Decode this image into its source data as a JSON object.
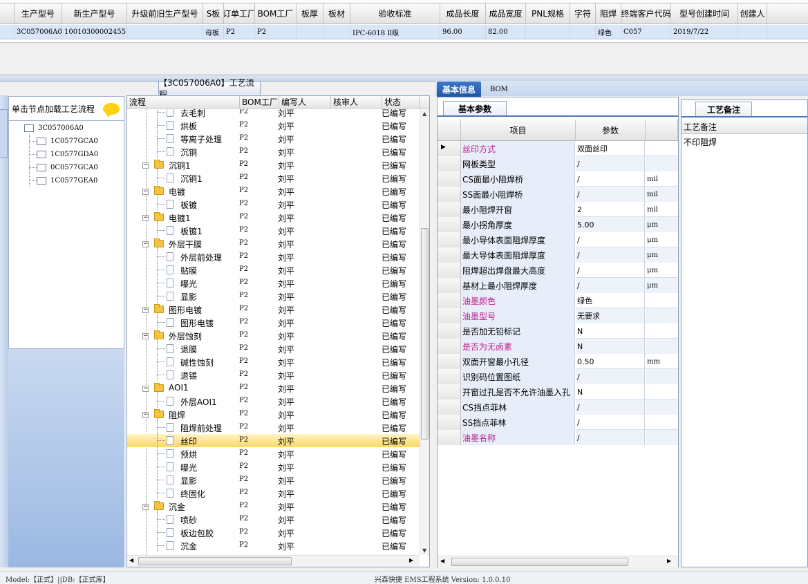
{
  "top_grid": {
    "headers": [
      "生产型号",
      "新生产型号",
      "升级前旧生产型号",
      "S板",
      "订单工厂",
      "BOM工厂",
      "板厚",
      "板材",
      "验收标准",
      "成品长度",
      "成品宽度",
      "PNL规格",
      "字符",
      "阻焊",
      "终端客户代码",
      "型号创建时间",
      "创建人"
    ],
    "row": [
      "3C057006A0",
      "10010300002455",
      "",
      "母板",
      "P2",
      "P2",
      "",
      "",
      "IPC-6018 Ⅱ级",
      "96.00",
      "82.00",
      "",
      "",
      "绿色",
      "C057",
      "2019/7/22",
      ""
    ]
  },
  "left_panel": {
    "header": "单击节点加载工艺流程",
    "nodes": [
      "3C057006A0",
      "1C0577GCA0",
      "1C0577GDA0",
      "0C0577GCA0",
      "1C0577GEA0"
    ]
  },
  "process": {
    "title": "【3C057006A0】工艺流程",
    "headers": [
      "流程",
      "BOM工厂",
      "编写人",
      "核审人",
      "状态"
    ],
    "rows": [
      {
        "name": "去毛刺",
        "type": "step",
        "bom": "P2",
        "writer": "刘平",
        "status": "已编写"
      },
      {
        "name": "烘板",
        "type": "step",
        "bom": "P2",
        "writer": "刘平",
        "status": "已编写"
      },
      {
        "name": "等离子处理",
        "type": "step",
        "bom": "P2",
        "writer": "刘平",
        "status": "已编写"
      },
      {
        "name": "沉铜",
        "type": "step",
        "bom": "P2",
        "writer": "刘平",
        "status": "已编写"
      },
      {
        "name": "沉铜1",
        "type": "group",
        "bom": "P2",
        "writer": "刘平",
        "status": "已编写"
      },
      {
        "name": "沉铜1",
        "type": "step",
        "bom": "P2",
        "writer": "刘平",
        "status": "已编写"
      },
      {
        "name": "电镀",
        "type": "group",
        "bom": "P2",
        "writer": "刘平",
        "status": "已编写"
      },
      {
        "name": "板镀",
        "type": "step",
        "bom": "P2",
        "writer": "刘平",
        "status": "已编写"
      },
      {
        "name": "电镀1",
        "type": "group",
        "bom": "P2",
        "writer": "刘平",
        "status": "已编写"
      },
      {
        "name": "板镀1",
        "type": "step",
        "bom": "P2",
        "writer": "刘平",
        "status": "已编写"
      },
      {
        "name": "外层干膜",
        "type": "group",
        "bom": "P2",
        "writer": "刘平",
        "status": "已编写"
      },
      {
        "name": "外层前处理",
        "type": "step",
        "bom": "P2",
        "writer": "刘平",
        "status": "已编写"
      },
      {
        "name": "贴膜",
        "type": "step",
        "bom": "P2",
        "writer": "刘平",
        "status": "已编写"
      },
      {
        "name": "曝光",
        "type": "step",
        "bom": "P2",
        "writer": "刘平",
        "status": "已编写"
      },
      {
        "name": "显影",
        "type": "step",
        "bom": "P2",
        "writer": "刘平",
        "status": "已编写"
      },
      {
        "name": "图形电镀",
        "type": "group",
        "bom": "P2",
        "writer": "刘平",
        "status": "已编写"
      },
      {
        "name": "图形电镀",
        "type": "step",
        "bom": "P2",
        "writer": "刘平",
        "status": "已编写"
      },
      {
        "name": "外层蚀刻",
        "type": "group",
        "bom": "P2",
        "writer": "刘平",
        "status": "已编写"
      },
      {
        "name": "退膜",
        "type": "step",
        "bom": "P2",
        "writer": "刘平",
        "status": "已编写"
      },
      {
        "name": "碱性蚀刻",
        "type": "step",
        "bom": "P2",
        "writer": "刘平",
        "status": "已编写"
      },
      {
        "name": "退锡",
        "type": "step",
        "bom": "P2",
        "writer": "刘平",
        "status": "已编写"
      },
      {
        "name": "AOI1",
        "type": "group",
        "bom": "P2",
        "writer": "刘平",
        "status": "已编写"
      },
      {
        "name": "外层AOI1",
        "type": "step",
        "bom": "P2",
        "writer": "刘平",
        "status": "已编写"
      },
      {
        "name": "阻焊",
        "type": "group",
        "bom": "P2",
        "writer": "刘平",
        "status": "已编写"
      },
      {
        "name": "阻焊前处理",
        "type": "step",
        "bom": "P2",
        "writer": "刘平",
        "status": "已编写"
      },
      {
        "name": "丝印",
        "type": "step",
        "bom": "P2",
        "writer": "刘平",
        "status": "已编写",
        "selected": true
      },
      {
        "name": "预烘",
        "type": "step",
        "bom": "P2",
        "writer": "刘平",
        "status": "已编写"
      },
      {
        "name": "曝光",
        "type": "step",
        "bom": "P2",
        "writer": "刘平",
        "status": "已编写"
      },
      {
        "name": "显影",
        "type": "step",
        "bom": "P2",
        "writer": "刘平",
        "status": "已编写"
      },
      {
        "name": "终固化",
        "type": "step",
        "bom": "P2",
        "writer": "刘平",
        "status": "已编写"
      },
      {
        "name": "沉金",
        "type": "group",
        "bom": "P2",
        "writer": "刘平",
        "status": "已编写"
      },
      {
        "name": "喷砂",
        "type": "step",
        "bom": "P2",
        "writer": "刘平",
        "status": "已编写"
      },
      {
        "name": "板边包胶",
        "type": "step",
        "bom": "P2",
        "writer": "刘平",
        "status": "已编写"
      },
      {
        "name": "沉金",
        "type": "step",
        "bom": "P2",
        "writer": "刘平",
        "status": "已编写"
      }
    ]
  },
  "right_tabs": [
    "基本信息",
    "BOM"
  ],
  "params": {
    "subtab": "基本参数",
    "headers": [
      "项目",
      "参数"
    ],
    "rows": [
      {
        "item": "丝印方式",
        "value": "双面丝印",
        "unit": "",
        "color": "mag",
        "current": true
      },
      {
        "item": "网板类型",
        "value": "/",
        "unit": ""
      },
      {
        "item": "CS面最小阻焊桥",
        "value": "/",
        "unit": "mil"
      },
      {
        "item": "SS面最小阻焊桥",
        "value": "/",
        "unit": "mil"
      },
      {
        "item": "最小阻焊开窗",
        "value": "2",
        "unit": "mil"
      },
      {
        "item": "最小拐角厚度",
        "value": "5.00",
        "unit": "μm"
      },
      {
        "item": "最小导体表面阻焊厚度",
        "value": "/",
        "unit": "μm"
      },
      {
        "item": "最大导体表面阻焊厚度",
        "value": "/",
        "unit": "μm"
      },
      {
        "item": "阻焊超出焊盘最大高度",
        "value": "/",
        "unit": "μm"
      },
      {
        "item": "基材上最小阻焊厚度",
        "value": "/",
        "unit": "μm"
      },
      {
        "item": "油墨颜色",
        "value": "绿色",
        "unit": "",
        "color": "mag"
      },
      {
        "item": "油墨型号",
        "value": "无要求",
        "unit": "",
        "color": "mag"
      },
      {
        "item": "是否加无铅标记",
        "value": "N",
        "unit": ""
      },
      {
        "item": "是否为无卤素",
        "value": "N",
        "unit": "",
        "color": "mag"
      },
      {
        "item": "双面开窗最小孔径",
        "value": "0.50",
        "unit": "mm"
      },
      {
        "item": "识别码位置图纸",
        "value": "/",
        "unit": ""
      },
      {
        "item": "开窗过孔是否不允许油墨入孔",
        "value": "N",
        "unit": ""
      },
      {
        "item": "CS挡点菲林",
        "value": "/",
        "unit": ""
      },
      {
        "item": "SS挡点菲林",
        "value": "/",
        "unit": ""
      },
      {
        "item": "油墨名称",
        "value": "/",
        "unit": "",
        "color": "mag"
      }
    ]
  },
  "remarks": {
    "tab": "工艺备注",
    "header": "工艺备注",
    "value": "不印阻焊"
  },
  "status_bar": {
    "left": "Model:【正式】||DB:【正式库】",
    "center": "兴森快捷 EMS工程系统 Version: 1.0.0.10"
  },
  "colors": {
    "accent": "#1f57a8",
    "selected_row": "#ffd867",
    "magenta": "#c0208e"
  }
}
